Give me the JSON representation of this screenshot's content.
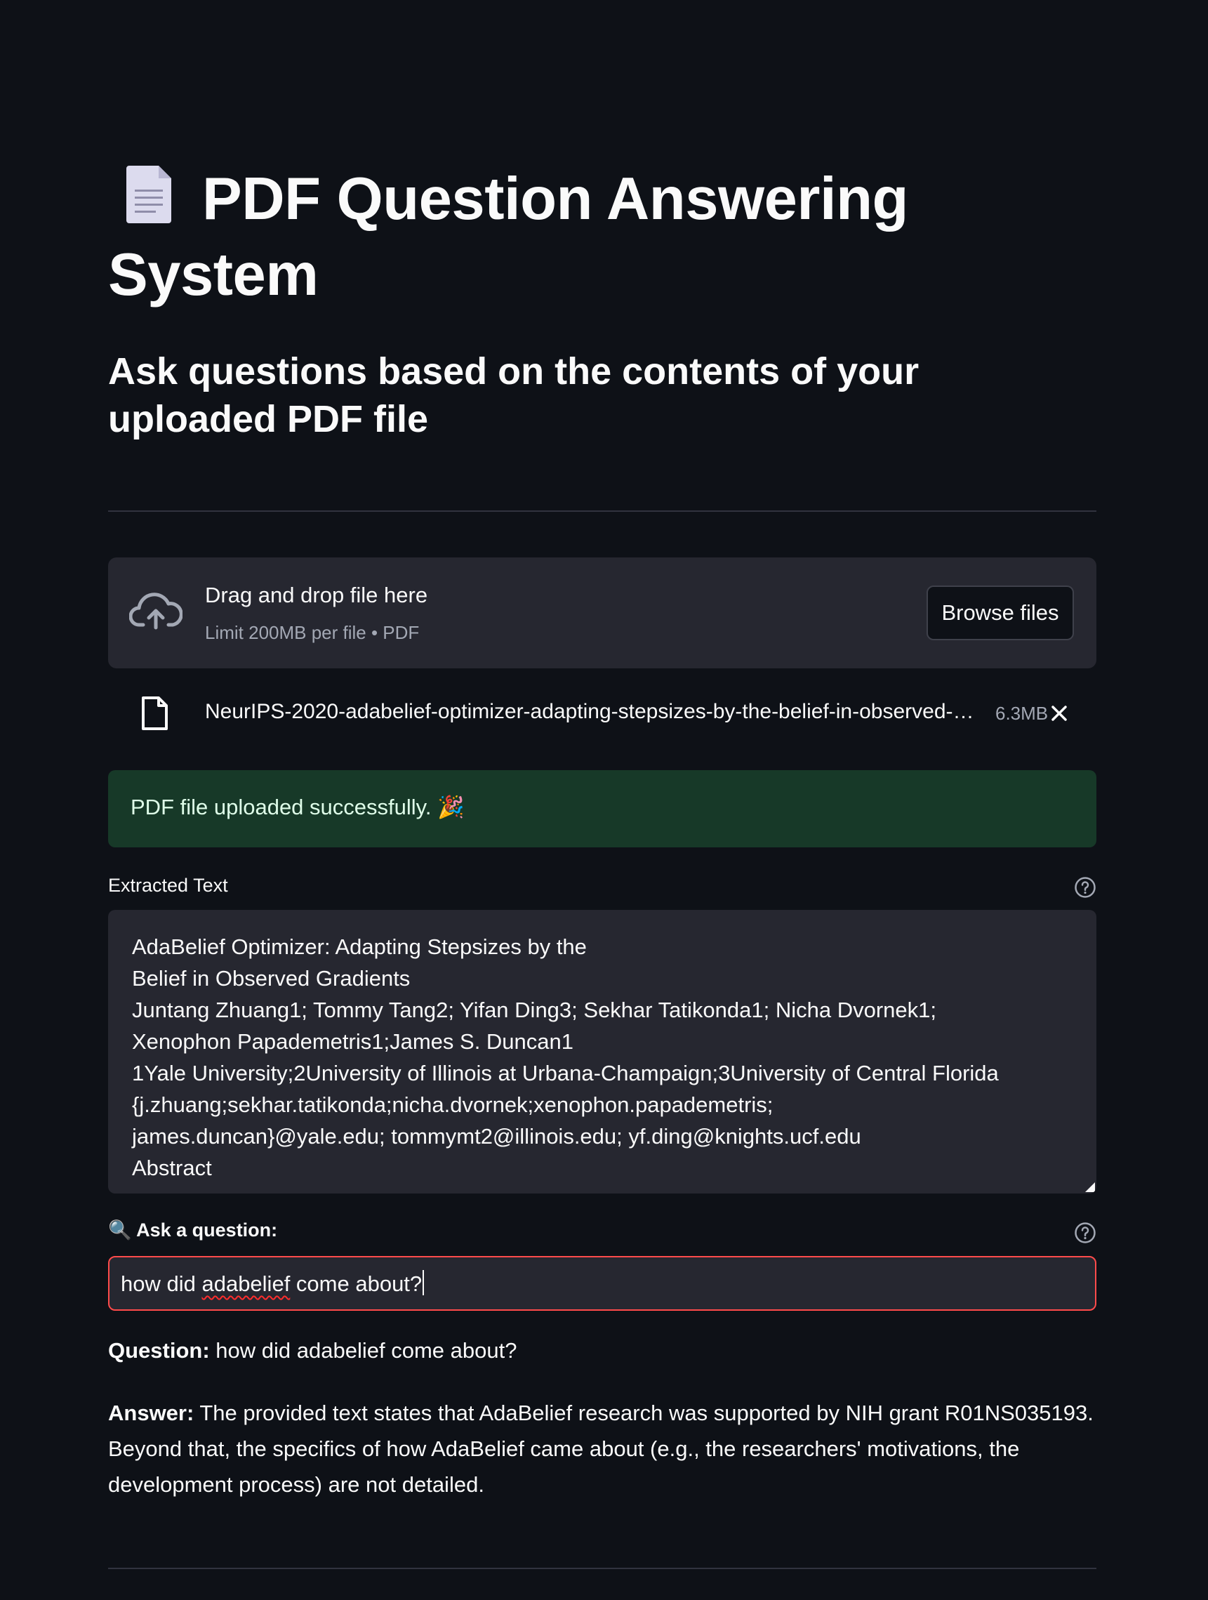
{
  "header": {
    "title": "PDF Question Answering System",
    "subtitle": "Ask questions based on the contents of your uploaded PDF file",
    "title_icon": "page-facing-up-icon"
  },
  "uploader": {
    "drop_title": "Drag and drop file here",
    "drop_limit": "Limit 200MB per file • PDF",
    "browse_label": "Browse files",
    "icons": {
      "upload": "cloud-upload-icon",
      "file": "file-icon",
      "remove": "close-icon"
    },
    "file": {
      "name": "NeurIPS-2020-adabelief-optimizer-adapting-stepsizes-by-the-belief-in-observed-…",
      "size": "6.3MB"
    }
  },
  "alert": {
    "text": "PDF file uploaded successfully. 🎉",
    "color": "#173928"
  },
  "extracted": {
    "label": "Extracted Text",
    "text": "AdaBelief Optimizer: Adapting Stepsizes by the\nBelief in Observed Gradients\nJuntang Zhuang1; Tommy Tang2; Yifan Ding3; Sekhar Tatikonda1; Nicha Dvornek1;\nXenophon Papademetris1;James S. Duncan1\n1Yale University;2University of Illinois at Urbana-Champaign;3University of Central Florida\n{j.zhuang;sekhar.tatikonda;nicha.dvornek;xenophon.papademetris;\njames.duncan}@yale.edu; tommymt2@illinois.edu; yf.ding@knights.ucf.edu\nAbstract"
  },
  "question_input": {
    "icon": "magnifying-glass-icon",
    "label_icon_glyph": "🔍",
    "label": "Ask a question:",
    "value_prefix": "how did ",
    "value_misspelled": "adabelief",
    "value_suffix": " come about?",
    "border_color": "#ff4b4b"
  },
  "qa": {
    "question_label": "Question:",
    "question_text": "how did adabelief come about?",
    "answer_label": "Answer:",
    "answer_text": "The provided text states that AdaBelief research was supported by NIH grant R01NS035193. Beyond that, the specifics of how AdaBelief came about (e.g., the researchers' motivations, the development process) are not detailed."
  },
  "colors": {
    "background": "#0e1117",
    "panel": "#262730",
    "text": "#fafafa",
    "muted": "#a3a8b4",
    "accent": "#ff4b4b"
  }
}
